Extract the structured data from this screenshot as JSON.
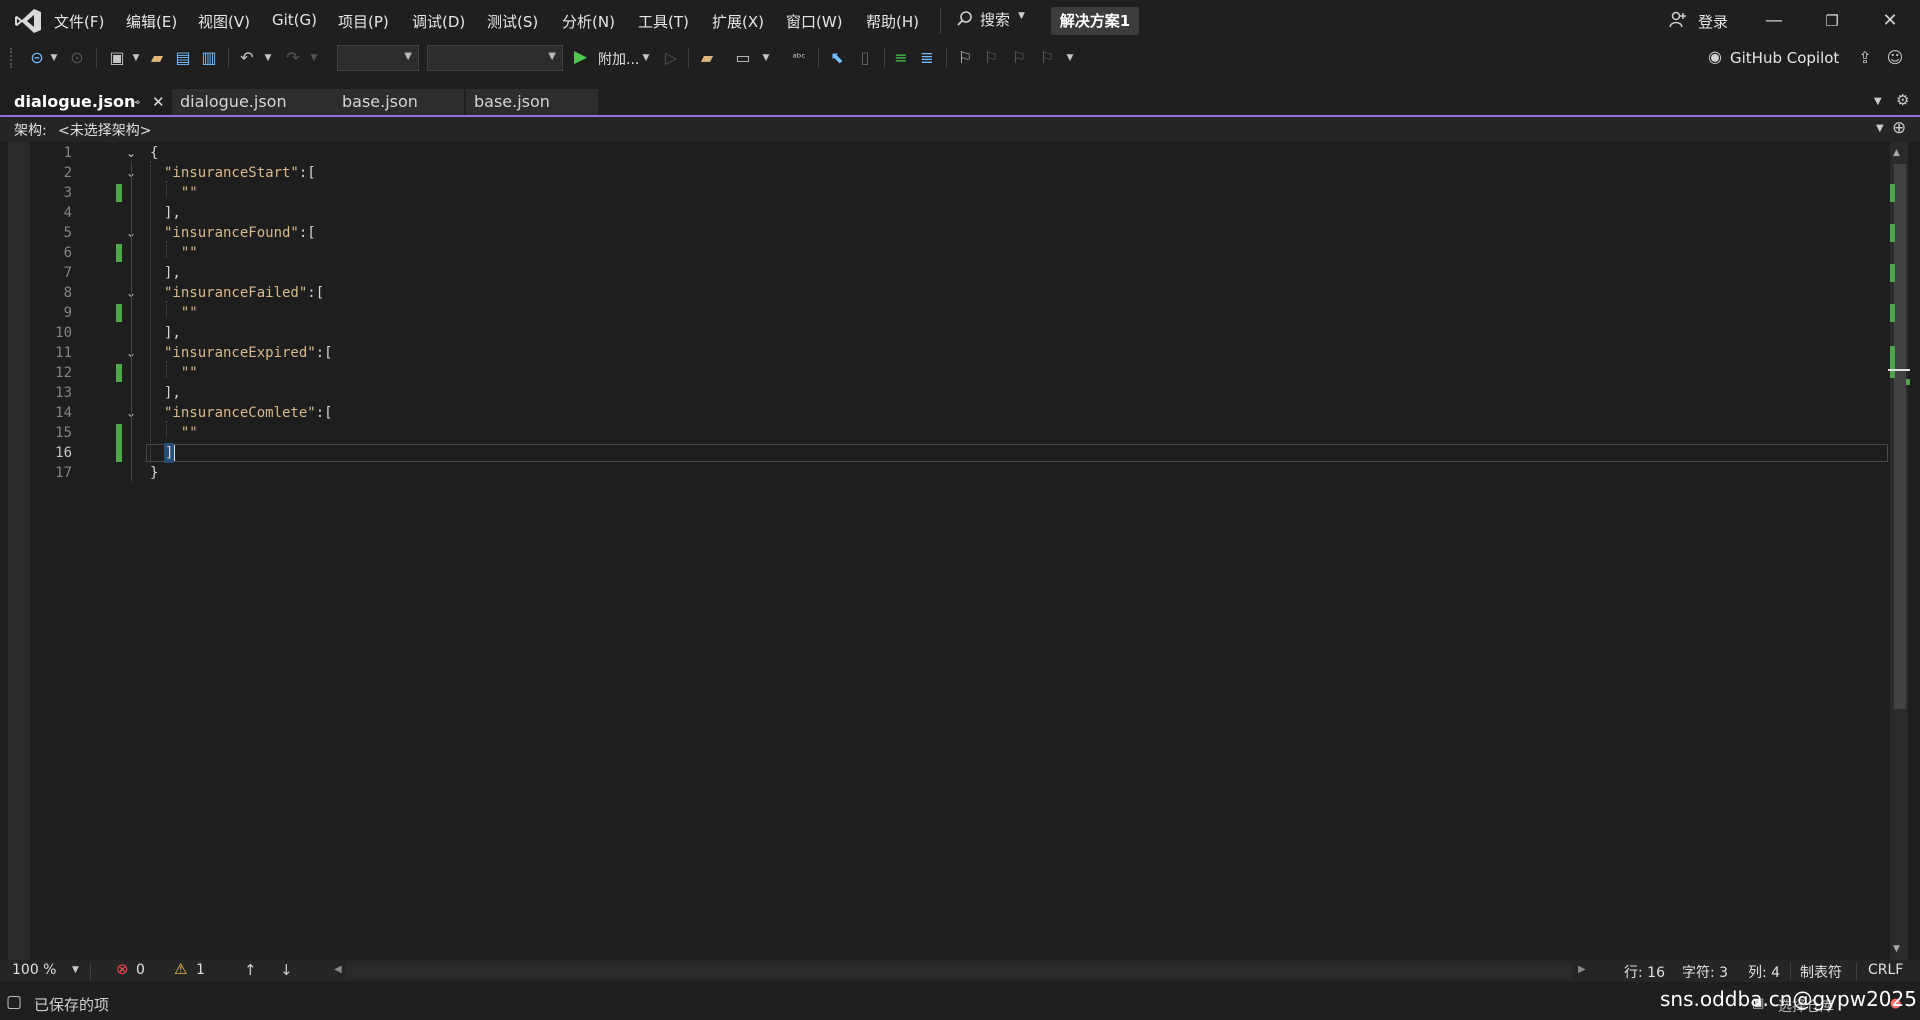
{
  "menu": {
    "file": "文件(F)",
    "edit": "编辑(E)",
    "view": "视图(V)",
    "git": "Git(G)",
    "project": "项目(P)",
    "debug": "调试(D)",
    "test": "测试(S)",
    "analyze": "分析(N)",
    "tools": "工具(T)",
    "extensions": "扩展(X)",
    "window": "窗口(W)",
    "help": "帮助(H)"
  },
  "search_label": "搜索",
  "solution_name": "解决方案1",
  "login_label": "登录",
  "toolbar": {
    "attach_label": "附加...",
    "copilot_label": "GitHub Copilot"
  },
  "tabs": [
    {
      "label": "dialogue.json"
    },
    {
      "label": "dialogue.json"
    },
    {
      "label": "base.json"
    },
    {
      "label": "base.json"
    }
  ],
  "schema": {
    "label": "架构:",
    "value": "<未选择架构>"
  },
  "code_lines": [
    {
      "n": "1",
      "text": "{"
    },
    {
      "n": "2",
      "key": "\"insuranceStart\"",
      "rest": ":["
    },
    {
      "n": "3",
      "text": "  \"\""
    },
    {
      "n": "4",
      "text": "],"
    },
    {
      "n": "5",
      "key": "\"insuranceFound\"",
      "rest": ":["
    },
    {
      "n": "6",
      "text": "  \"\""
    },
    {
      "n": "7",
      "text": "],"
    },
    {
      "n": "8",
      "key": "\"insuranceFailed\"",
      "rest": ":["
    },
    {
      "n": "9",
      "text": "  \"\""
    },
    {
      "n": "10",
      "text": "],"
    },
    {
      "n": "11",
      "key": "\"insuranceExpired\"",
      "rest": ":["
    },
    {
      "n": "12",
      "text": "  \"\""
    },
    {
      "n": "13",
      "text": "],"
    },
    {
      "n": "14",
      "key": "\"insuranceComlete\"",
      "rest": ":["
    },
    {
      "n": "15",
      "text": "  \"\""
    },
    {
      "n": "16",
      "text": "]"
    },
    {
      "n": "17",
      "text": "}"
    }
  ],
  "bottom": {
    "zoom": "100 %",
    "errors": "0",
    "warnings": "1",
    "line": "行: 16",
    "char": "字符: 3",
    "col": "列: 4",
    "tabs_mode": "制表符",
    "eol": "CRLF"
  },
  "status": {
    "saved": "已保存的项",
    "repo": "选择仓库",
    "watermark": "sns.oddba.cn@gypw2025"
  },
  "colors": {
    "accent": "#8f72d8",
    "change_marker": "#4ea84a",
    "string": "#d6b98c",
    "error": "#e51400",
    "warning": "#f2c94c"
  }
}
